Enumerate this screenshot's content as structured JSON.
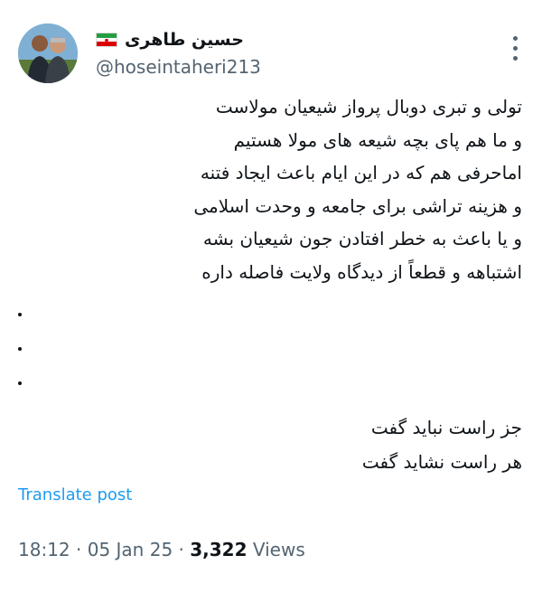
{
  "author": {
    "display_name": "حسین طاهری",
    "handle": "@hoseintaheri213"
  },
  "tweet": {
    "lines": [
      "تولی و تبری دوبال پرواز شیعیان مولاست",
      "و ما هم پای بچه شیعه های مولا هستیم",
      "اماحرفی هم که در این ایام باعث ایجاد فتنه",
      "و هزینه تراشی برای جامعه و وحدت اسلامی",
      "و یا باعث به خطر افتادن جون شیعیان بشه",
      "اشتباهه و قطعاً از دیدگاه ولایت فاصله داره"
    ],
    "dots": [
      ".",
      ".",
      "."
    ],
    "closing": [
      "جز راست نباید گفت",
      "هر راست نشاید گفت"
    ]
  },
  "translate_label": "Translate post",
  "meta": {
    "time": "18:12",
    "separator": "·",
    "date": "05 Jan 25",
    "views_count": "3,322",
    "views_label": "Views"
  },
  "colors": {
    "link": "#1d9bf0",
    "secondary_text": "#536471",
    "primary_text": "#0f1419"
  }
}
